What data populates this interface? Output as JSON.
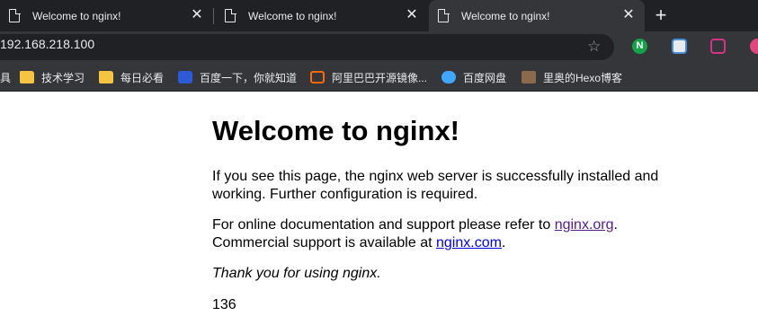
{
  "tabs": [
    {
      "title": "Welcome to nginx!",
      "active": false
    },
    {
      "title": "Welcome to nginx!",
      "active": false
    },
    {
      "title": "Welcome to nginx!",
      "active": true
    }
  ],
  "toolbar": {
    "url": "192.168.218.100",
    "bookmark_star_icon": "star-add-icon",
    "extensions": [
      "n-extension-icon",
      "translate-extension-icon",
      "video-extension-icon",
      "red-extension-icon"
    ]
  },
  "bookmarks": {
    "partial_left": "具",
    "items": [
      {
        "label": "技术学习",
        "icon": "folder-icon"
      },
      {
        "label": "每日必看",
        "icon": "folder-icon"
      },
      {
        "label": "百度一下，你就知道",
        "icon": "baidu-paw-icon"
      },
      {
        "label": "阿里巴巴开源镜像...",
        "icon": "aliyun-icon"
      },
      {
        "label": "百度网盘",
        "icon": "baidu-cloud-icon"
      },
      {
        "label": "里奥的Hexo博客",
        "icon": "avatar-icon"
      }
    ]
  },
  "page": {
    "heading": "Welcome to nginx!",
    "p1": "If you see this page, the nginx web server is successfully installed and working. Further configuration is required.",
    "p2_prefix": "For online documentation and support please refer to ",
    "link1": "nginx.org",
    "p2_mid": ".",
    "p2_line2": "Commercial support is available at ",
    "link2": "nginx.com",
    "p2_end": ".",
    "p3": "Thank you for using nginx.",
    "p4": "136"
  },
  "colors": {
    "tabstrip": "#202124",
    "toolbar": "#35363a",
    "visited_link": "#551a8b",
    "link": "#0000ee"
  }
}
